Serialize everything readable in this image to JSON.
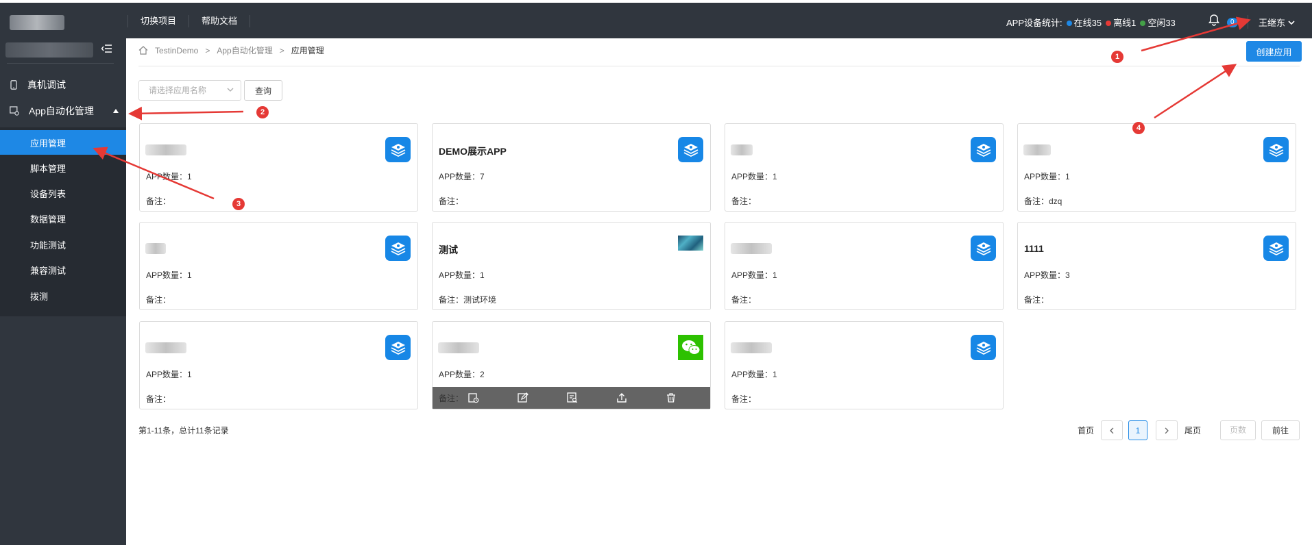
{
  "topbar": {
    "nav": [
      "切换项目",
      "帮助文档"
    ],
    "stats_label": "APP设备统计:",
    "online": "在线35",
    "offline": "离线1",
    "idle": "空闲33",
    "badge_count": "0",
    "user_name": "王继东",
    "colors": {
      "online": "#1e88e5",
      "offline": "#e53935",
      "idle": "#43a047"
    }
  },
  "sidebar": {
    "items": [
      {
        "label": "真机调试",
        "icon": "phone-icon"
      },
      {
        "label": "App自动化管理",
        "icon": "settings-panel-icon"
      }
    ],
    "sub_items": [
      "应用管理",
      "脚本管理",
      "设备列表",
      "数据管理",
      "功能测试",
      "兼容测试",
      "拨测"
    ],
    "active_sub": "应用管理"
  },
  "breadcrumb": [
    "TestinDemo",
    "App自动化管理",
    "应用管理"
  ],
  "toolbar": {
    "create_label": "创建应用",
    "select_placeholder": "请选择应用名称",
    "query_label": "查询"
  },
  "cards": [
    {
      "title": "",
      "count": "APP数量：1",
      "note": "备注：",
      "icon": "app-icon"
    },
    {
      "title": "DEMO展示APP",
      "count": "APP数量：7",
      "note": "备注：",
      "icon": "app-icon"
    },
    {
      "title": "",
      "count": "APP数量：1",
      "note": "备注：",
      "icon": "app-icon"
    },
    {
      "title": "",
      "count": "APP数量：1",
      "note": "备注：dzq",
      "icon": "app-icon"
    },
    {
      "title": "",
      "count": "APP数量：1",
      "note": "备注：",
      "icon": "app-icon"
    },
    {
      "title": "测试",
      "count": "APP数量：1",
      "note": "备注：测试环境",
      "icon": "image-thumb"
    },
    {
      "title": "",
      "count": "APP数量：1",
      "note": "备注：",
      "icon": "app-icon"
    },
    {
      "title": "1111",
      "count": "APP数量：3",
      "note": "备注：",
      "icon": "app-icon"
    },
    {
      "title": "",
      "count": "APP数量：1",
      "note": "备注：",
      "icon": "app-icon"
    },
    {
      "title": "",
      "count": "APP数量：2",
      "note": "备注：",
      "icon": "wechat-icon"
    },
    {
      "title": "",
      "count": "APP数量：1",
      "note": "备注：",
      "icon": "app-icon"
    }
  ],
  "card_actions": [
    "schedule-icon",
    "edit-icon",
    "report-icon",
    "upload-icon",
    "trash-icon"
  ],
  "pagination": {
    "summary": "第1-11条，总计11条记录",
    "first": "首页",
    "last": "尾页",
    "current_page": "1",
    "page_placeholder": "页数",
    "go_label": "前往"
  },
  "annotations": [
    "1",
    "2",
    "3",
    "4"
  ]
}
